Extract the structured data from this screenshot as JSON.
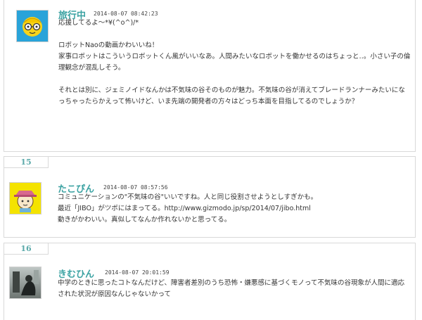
{
  "comments": [
    {
      "number": "",
      "name": "旅行中",
      "timestamp": "2014-08-07 08:42:23",
      "lines": [
        "応援してるよ〜*¥(^o^)/*",
        "",
        "ロボットNaoの動画かわいいね！",
        "家事ロボットはこういうロボットくん風がいいなあ。人間みたいなロボットを働かせるのはちょっと‥。小さい子の倫理観念が混乱しそう。",
        "",
        "それとは別に、ジェミノイドなんかは不気味の谷そのものが魅力。不気味の谷が消えてブレードランナーみたいになっちゃったらかえって怖いけど、いま先端の開発者の方々はどっち本面を目指してるのでしょうか？"
      ],
      "avatar_icon": "yellow-glasses-character-icon"
    },
    {
      "number": "15",
      "name": "たこぴん",
      "timestamp": "2014-08-07 08:57:56",
      "lines": [
        "コミュニケーションの\"不気味の谷\"いいですね。人と同じ役割させようとしすぎかも。",
        "最近「JIBO」がツボにはまってる。http://www.gizmodo.jp/sp/2014/07/jibo.html",
        "動きがかわいい。真似してなんか作れないかと思ってる。"
      ],
      "avatar_icon": "hat-character-icon"
    },
    {
      "number": "16",
      "name": "きむひん",
      "timestamp": "2014-08-07 20:01:59",
      "lines": [
        "中学のときに思ったコトなんだけど、障害者差別のうち恐怖・嫌悪感に基づくモノって不気味の谷現象が人間に適応された状況が原因なんじゃないかって"
      ],
      "avatar_icon": "photo-avatar-icon"
    }
  ]
}
